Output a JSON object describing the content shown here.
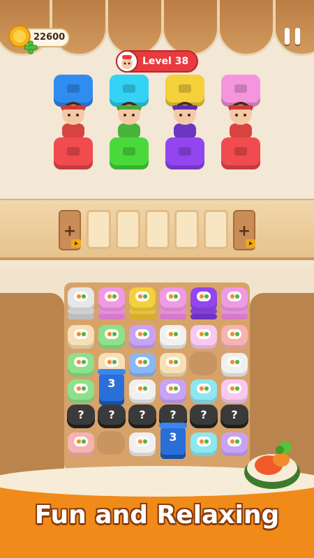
{
  "hud": {
    "coins": "22600",
    "level_label": "Level 38"
  },
  "icons": {
    "coin": "coin-icon",
    "plus": "plus-icon",
    "pause": "pause-icon",
    "level": "chef-face-icon",
    "ad": "video-ad-icon"
  },
  "colors": {
    "seat_row1": [
      "#2f8df2",
      "#32d3f5",
      "#f4d03a",
      "#f595dd"
    ],
    "seat_row2": [
      "#f04b4e",
      "#49d93b",
      "#9345ef",
      "#f04b4e"
    ],
    "hair": [
      "#cf3a3a",
      "#4aa83a",
      "#5c2db4",
      "#cf3a3a"
    ]
  },
  "slots": {
    "add_label": "+"
  },
  "board": {
    "counters": [
      "3",
      "3"
    ],
    "mystery_label": "?"
  },
  "footer": {
    "tagline": "Fun and Relaxing"
  }
}
